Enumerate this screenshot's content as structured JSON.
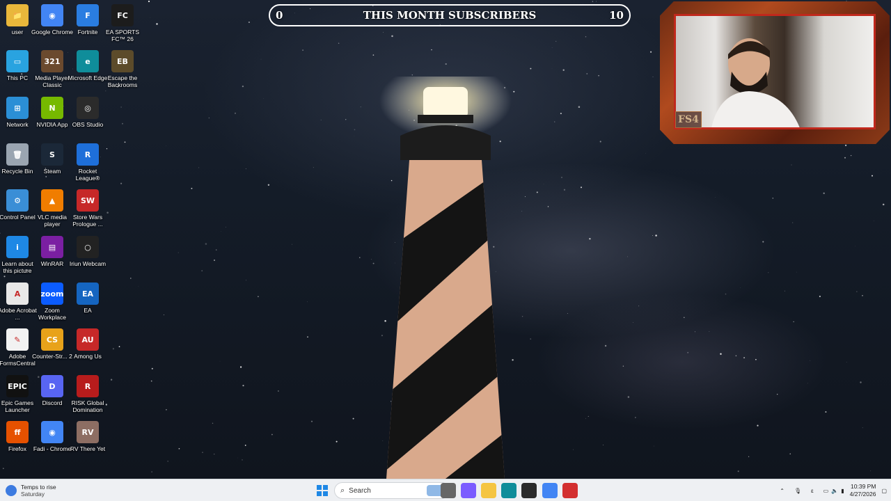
{
  "overlay": {
    "subscribers": {
      "title": "THIS MONTH SUBSCRIBERS",
      "current": "0",
      "goal": "10"
    },
    "webcam_badge": "FS4"
  },
  "desktop": {
    "icons": [
      {
        "label": "user",
        "color": "#e9b73b",
        "glyph": "📁"
      },
      {
        "label": "Google Chrome",
        "color": "#4285f4",
        "glyph": "◉"
      },
      {
        "label": "Fortnite",
        "color": "#2a7de1",
        "glyph": "F"
      },
      {
        "label": "EA SPORTS FC™ 26",
        "color": "#1c1c1c",
        "glyph": "FC"
      },
      {
        "label": "This PC",
        "color": "#29a3e0",
        "glyph": "▭"
      },
      {
        "label": "Media Player Classic",
        "color": "#6b4a2e",
        "glyph": "321"
      },
      {
        "label": "Microsoft Edge",
        "color": "#0f8d9a",
        "glyph": "e"
      },
      {
        "label": "Escape the Backrooms",
        "color": "#5c4b2a",
        "glyph": "EB"
      },
      {
        "label": "Network",
        "color": "#2b8fd6",
        "glyph": "⊞"
      },
      {
        "label": "NVIDIA App",
        "color": "#76b900",
        "glyph": "N"
      },
      {
        "label": "OBS Studio",
        "color": "#2b2b2b",
        "glyph": "◎"
      },
      {
        "label": "Recycle Bin",
        "color": "#9aa5b1",
        "glyph": "🗑"
      },
      {
        "label": "Steam",
        "color": "#1b2838",
        "glyph": "S"
      },
      {
        "label": "Rocket League®",
        "color": "#1e6fd9",
        "glyph": "R"
      },
      {
        "label": "Control Panel",
        "color": "#3a8ed6",
        "glyph": "⚙"
      },
      {
        "label": "VLC media player",
        "color": "#f07d00",
        "glyph": "▲"
      },
      {
        "label": "Store Wars Prologue ...",
        "color": "#c62828",
        "glyph": "SW"
      },
      {
        "label": "Learn about this picture",
        "color": "#1e88e5",
        "glyph": "i"
      },
      {
        "label": "WinRAR",
        "color": "#7b1fa2",
        "glyph": "▤"
      },
      {
        "label": "Iriun Webcam",
        "color": "#222",
        "glyph": "○"
      },
      {
        "label": "Adobe Acrobat ...",
        "color": "#e8e8e8",
        "glyph": "A"
      },
      {
        "label": "Zoom Workplace",
        "color": "#0b5cff",
        "glyph": "zoom"
      },
      {
        "label": "EA",
        "color": "#1565c0",
        "glyph": "EA"
      },
      {
        "label": "Adobe FormsCentral",
        "color": "#f2f2f2",
        "glyph": "✎"
      },
      {
        "label": "Counter-Str... 2",
        "color": "#e8a21a",
        "glyph": "CS"
      },
      {
        "label": "Among Us",
        "color": "#c62828",
        "glyph": "AU"
      },
      {
        "label": "Epic Games Launcher",
        "color": "#111",
        "glyph": "EPIC"
      },
      {
        "label": "Discord",
        "color": "#5865f2",
        "glyph": "D"
      },
      {
        "label": "RISK Global Domination",
        "color": "#b71c1c",
        "glyph": "R"
      },
      {
        "label": "Firefox",
        "color": "#e65100",
        "glyph": "ff"
      },
      {
        "label": "Fadi - Chrome",
        "color": "#4285f4",
        "glyph": "◉"
      },
      {
        "label": "RV There Yet",
        "color": "#8d6e63",
        "glyph": "RV"
      }
    ]
  },
  "taskbar": {
    "weather": {
      "line1": "Temps to rise",
      "line2": "Saturday"
    },
    "search_label": "Search",
    "apps": [
      {
        "name": "task-view",
        "color": "#666"
      },
      {
        "name": "copilot",
        "color": "#7b5cff"
      },
      {
        "name": "file-explorer",
        "color": "#f5c542"
      },
      {
        "name": "edge",
        "color": "#0f8d9a"
      },
      {
        "name": "store",
        "color": "#2b2b2b"
      },
      {
        "name": "chrome",
        "color": "#4285f4"
      },
      {
        "name": "recorder",
        "color": "#d32f2f"
      }
    ],
    "tray": {
      "lang": "ε",
      "time": "10:39 PM",
      "date": "4/27/2026"
    }
  }
}
